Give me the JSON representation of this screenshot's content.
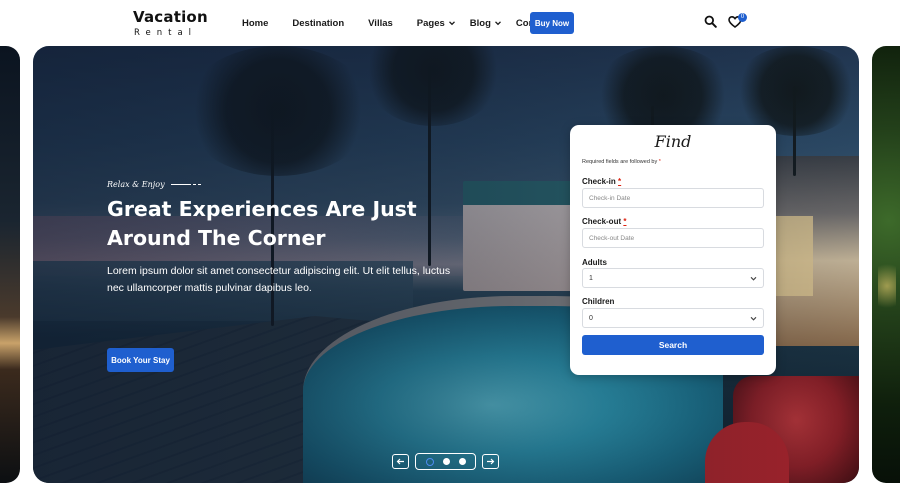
{
  "logo": {
    "title": "Vacation",
    "subtitle": "Rental"
  },
  "nav": {
    "items": [
      {
        "label": "Home"
      },
      {
        "label": "Destination"
      },
      {
        "label": "Villas"
      },
      {
        "label": "Pages",
        "dropdown": true
      },
      {
        "label": "Blog",
        "dropdown": true
      },
      {
        "label": "Contact"
      }
    ],
    "buy_now": "Buy Now",
    "cart_count": "0"
  },
  "hero": {
    "tagline": "Relax & Enjoy",
    "title": "Great Experiences Are Just Around The Corner",
    "text": "Lorem ipsum dolor sit amet consectetur adipiscing elit. Ut elit tellus, luctus nec ullamcorper mattis pulvinar dapibus leo.",
    "cta": "Book Your Stay"
  },
  "find_form": {
    "title": "Find",
    "required_note": "Required fields are followed by",
    "required_mark": "*",
    "checkin_label": "Check-in",
    "checkin_placeholder": "Check-in Date",
    "checkout_label": "Check-out",
    "checkout_placeholder": "Check-out Date",
    "adults_label": "Adults",
    "adults_value": "1",
    "children_label": "Children",
    "children_value": "0",
    "search_label": "Search"
  },
  "slider": {
    "slide_count": 3,
    "active_index": 0
  },
  "colors": {
    "accent": "#1f5fcf",
    "dot_active": "#4d8cf0"
  }
}
